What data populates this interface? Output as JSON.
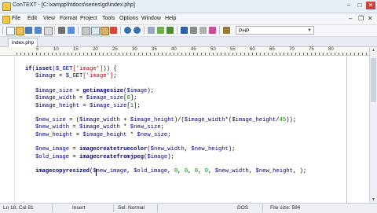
{
  "window": {
    "title": "ConTEXT - [C:\\xampp\\htdocs\\series\\gd\\index.php]"
  },
  "menu": [
    "File",
    "Edit",
    "View",
    "Format",
    "Project",
    "Tools",
    "Options",
    "Window",
    "Help"
  ],
  "toolbar": {
    "highlighter": "PHP"
  },
  "tabs": [
    {
      "label": "index.php"
    }
  ],
  "ruler": [
    "5",
    "10",
    "15",
    "20",
    "25",
    "30",
    "35",
    "40",
    "45",
    "50",
    "55",
    "60",
    "65",
    "70",
    "75",
    "80"
  ],
  "code": [
    {
      "parts": [
        [
          "kw",
          "if"
        ],
        [
          "",
          "("
        ],
        [
          "kw",
          "isset"
        ],
        [
          "",
          ""
        ],
        [
          "var",
          "($_GET"
        ],
        [
          "str",
          "['image']"
        ],
        [
          "",
          ")) {"
        ]
      ]
    },
    {
      "parts": [
        [
          "var",
          "   $image"
        ],
        [
          "",
          " = "
        ],
        [
          "var",
          "$_GET"
        ],
        [
          "str",
          "['image']"
        ],
        [
          "",
          ";"
        ]
      ]
    },
    {
      "parts": []
    },
    {
      "parts": [
        [
          "var",
          "   $image_size"
        ],
        [
          "",
          " = "
        ],
        [
          "kw",
          "getimagesize"
        ],
        [
          "",
          "("
        ],
        [
          "var",
          "$image"
        ],
        [
          "",
          ");"
        ]
      ]
    },
    {
      "parts": [
        [
          "var",
          "   $image_width"
        ],
        [
          "",
          " = "
        ],
        [
          "var",
          "$image_size"
        ],
        [
          "",
          "["
        ],
        [
          "num",
          "0"
        ],
        [
          "",
          "];"
        ]
      ]
    },
    {
      "parts": [
        [
          "var",
          "   $image_height"
        ],
        [
          "",
          " = "
        ],
        [
          "var",
          "$image_size"
        ],
        [
          "",
          "["
        ],
        [
          "num",
          "1"
        ],
        [
          "",
          "];"
        ]
      ]
    },
    {
      "parts": []
    },
    {
      "parts": [
        [
          "var",
          "   $new_size"
        ],
        [
          "",
          " = ("
        ],
        [
          "var",
          "$image_width"
        ],
        [
          "",
          " + "
        ],
        [
          "var",
          "$image_height"
        ],
        [
          "",
          ")/("
        ],
        [
          "var",
          "$image_width"
        ],
        [
          "",
          "*("
        ],
        [
          "var",
          "$image_height"
        ],
        [
          "",
          "/"
        ],
        [
          "num",
          "45"
        ],
        [
          "",
          "));"
        ]
      ]
    },
    {
      "parts": [
        [
          "var",
          "   $new_width"
        ],
        [
          "",
          " = "
        ],
        [
          "var",
          "$image_width"
        ],
        [
          "",
          " * "
        ],
        [
          "var",
          "$new_size"
        ],
        [
          "",
          ";"
        ]
      ]
    },
    {
      "parts": [
        [
          "var",
          "   $new_height"
        ],
        [
          "",
          " = "
        ],
        [
          "var",
          "$image_height"
        ],
        [
          "",
          " * "
        ],
        [
          "var",
          "$new_size"
        ],
        [
          "",
          ";"
        ]
      ]
    },
    {
      "parts": []
    },
    {
      "parts": [
        [
          "var",
          "   $new_image"
        ],
        [
          "",
          " = "
        ],
        [
          "kw",
          "imagecreatetruecolor"
        ],
        [
          "",
          "("
        ],
        [
          "var",
          "$new_width"
        ],
        [
          "",
          ", "
        ],
        [
          "var",
          "$new_height"
        ],
        [
          "",
          ");"
        ]
      ]
    },
    {
      "parts": [
        [
          "var",
          "   $old_image"
        ],
        [
          "",
          " = "
        ],
        [
          "kw",
          "imagecreatefromjpeg"
        ],
        [
          "",
          "("
        ],
        [
          "var",
          "$image"
        ],
        [
          "",
          ");"
        ]
      ]
    },
    {
      "parts": []
    },
    {
      "parts": [
        [
          "kw",
          "   imagecopyresized"
        ],
        [
          "",
          "("
        ],
        [
          "var",
          "$new_image"
        ],
        [
          "",
          ", "
        ],
        [
          "var",
          "$old_image"
        ],
        [
          "",
          ", "
        ],
        [
          "num",
          "0"
        ],
        [
          "",
          ", "
        ],
        [
          "num",
          "0"
        ],
        [
          "",
          ", "
        ],
        [
          "num",
          "0"
        ],
        [
          "",
          ", "
        ],
        [
          "num",
          "0"
        ],
        [
          "",
          ", "
        ],
        [
          "var",
          "$new_width"
        ],
        [
          "",
          ", "
        ],
        [
          "var",
          "$new_height"
        ],
        [
          "",
          ", );"
        ]
      ]
    }
  ],
  "status": {
    "position": "Ln 18, Col 81",
    "mode": "Insert",
    "selection": "Sel: Normal",
    "format": "DOS",
    "filesize": "File size: 594"
  }
}
